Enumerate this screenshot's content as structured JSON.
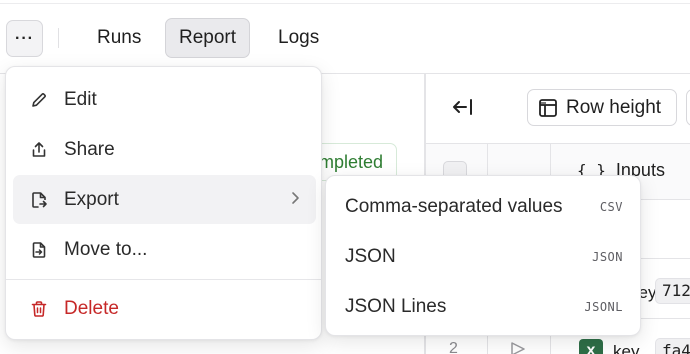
{
  "topbar": {
    "more_label": "···",
    "tabs": [
      {
        "label": "Runs",
        "active": false
      },
      {
        "label": "Report",
        "active": true
      },
      {
        "label": "Logs",
        "active": false
      }
    ]
  },
  "background": {
    "status_text": "Completed",
    "collapse_icon": "collapse-left-icon",
    "row_height_label": "Row height",
    "inputs_header": "Inputs",
    "rows": [
      {
        "key_text": "key",
        "value_chip": "712"
      },
      {
        "number": "2",
        "key_text": "key",
        "value_chip": "fa4"
      }
    ]
  },
  "menu": {
    "items": [
      {
        "label": "Edit",
        "icon": "pencil-icon"
      },
      {
        "label": "Share",
        "icon": "share-icon"
      },
      {
        "label": "Export",
        "icon": "export-file-icon",
        "has_submenu": true,
        "highlighted": true
      },
      {
        "label": "Move to...",
        "icon": "move-file-icon"
      },
      {
        "label": "Delete",
        "icon": "trash-icon",
        "danger": true
      }
    ]
  },
  "submenu": {
    "items": [
      {
        "label": "Comma-separated values",
        "shortcut": "CSV"
      },
      {
        "label": "JSON",
        "shortcut": "JSON"
      },
      {
        "label": "JSON Lines",
        "shortcut": "JSONL"
      }
    ]
  },
  "colors": {
    "accent_active_tab": "#eaeaed",
    "danger": "#c62828",
    "status_green": "#2e7d32",
    "x_badge_green": "#2e6e47"
  }
}
